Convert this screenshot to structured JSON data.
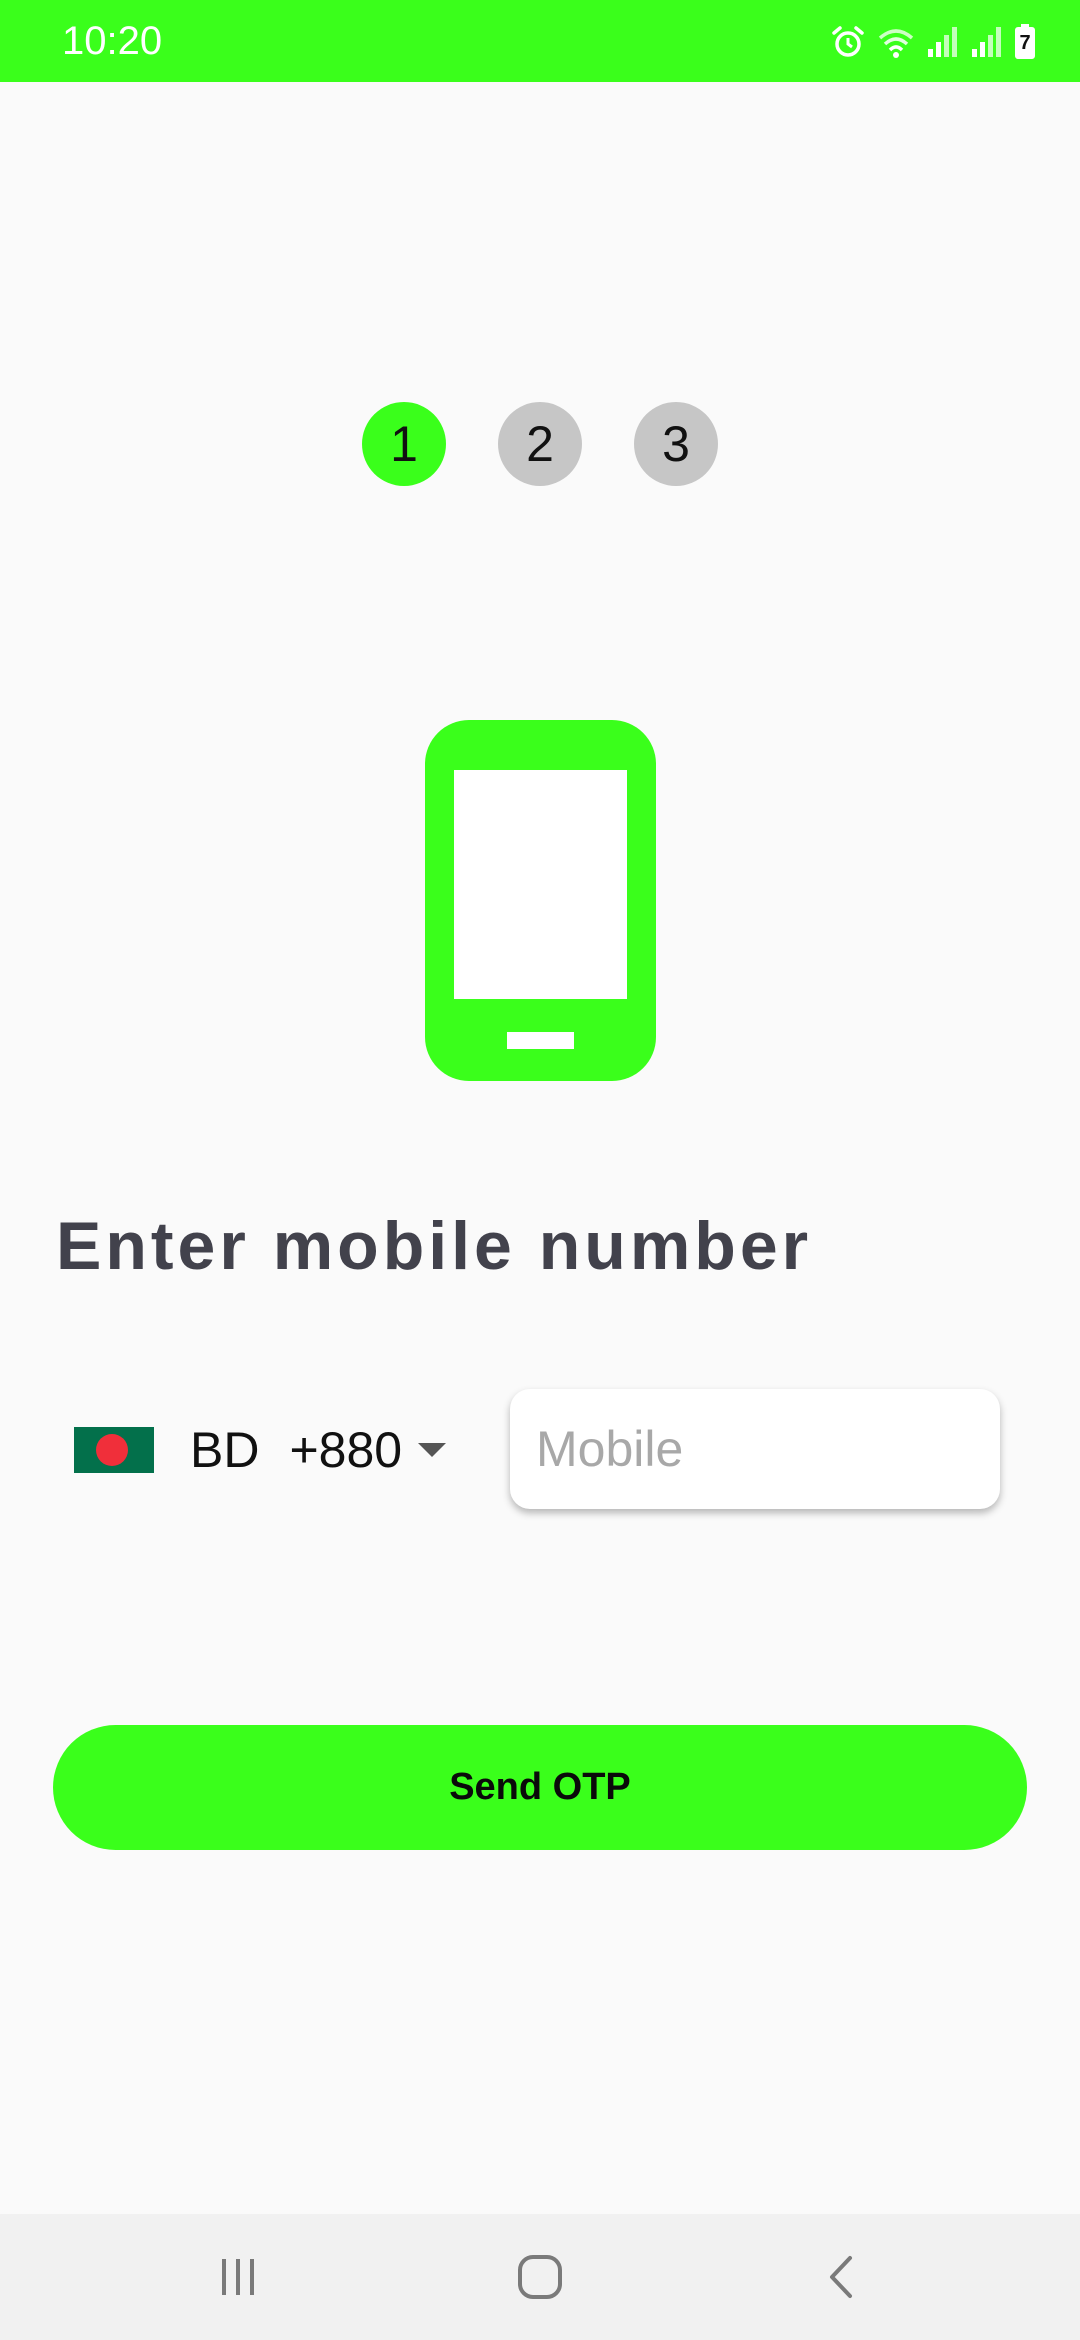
{
  "status_bar": {
    "time": "10:20",
    "battery_level": "7",
    "icons": [
      "alarm-icon",
      "wifi-icon",
      "signal-icon",
      "signal-icon",
      "battery-icon"
    ],
    "background_color": "#3aff1b"
  },
  "stepper": {
    "steps": [
      "1",
      "2",
      "3"
    ],
    "active_step": 1,
    "active_color": "#3aff1b",
    "inactive_color": "#c6c6c6"
  },
  "illustration": {
    "icon": "smartphone-icon",
    "color": "#3aff1b"
  },
  "form": {
    "title": "Enter mobile number",
    "country": {
      "flag": "bangladesh-flag-icon",
      "code": "BD",
      "dial_code": "+880"
    },
    "mobile_placeholder": "Mobile",
    "mobile_value": ""
  },
  "actions": {
    "send_otp_label": "Send OTP",
    "button_color": "#3aff1b"
  },
  "nav_bar": {
    "buttons": [
      "recents-icon",
      "home-icon",
      "back-icon"
    ]
  }
}
